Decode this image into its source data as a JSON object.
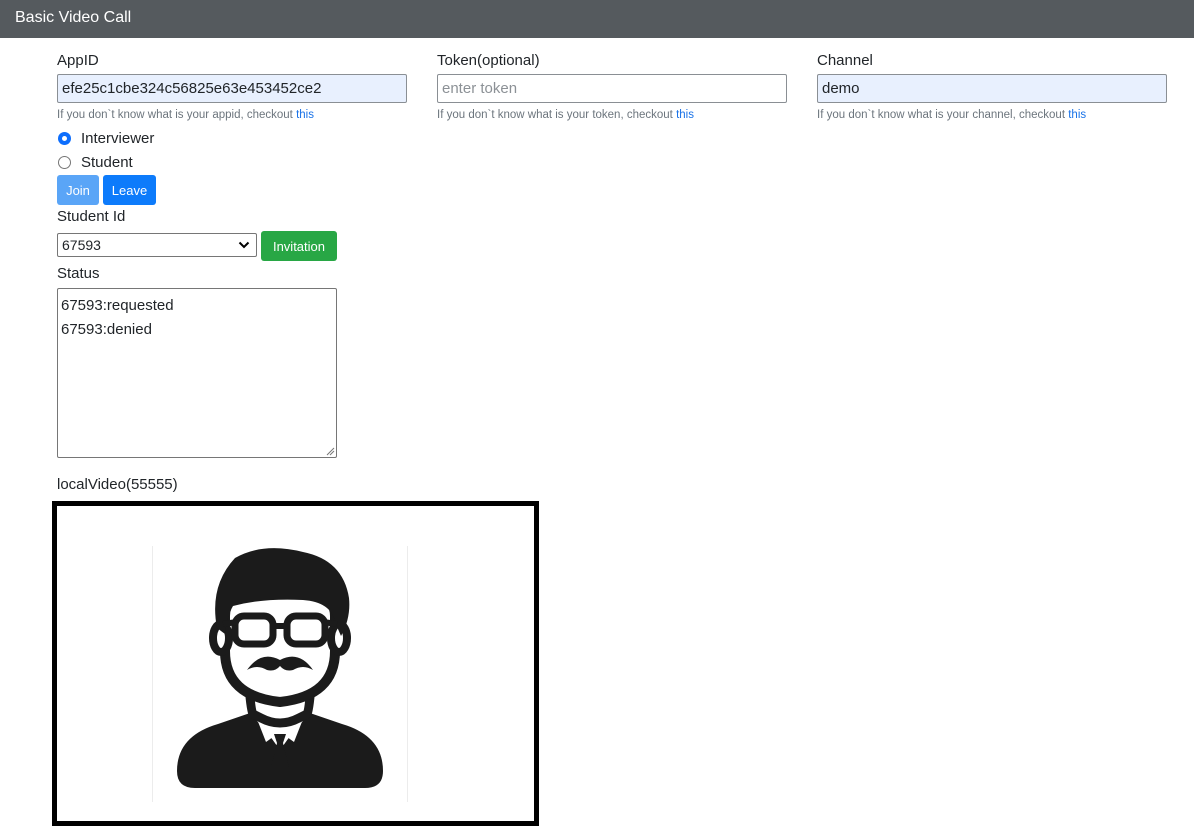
{
  "header": {
    "title": "Basic Video Call"
  },
  "form": {
    "appid": {
      "label": "AppID",
      "value": "efe25c1cbe324c56825e63e453452ce2",
      "help": "If you don`t know what is your appid, checkout ",
      "link": "this"
    },
    "token": {
      "label": "Token(optional)",
      "value": "",
      "placeholder": "enter token",
      "help": "If you don`t know what is your token, checkout ",
      "link": "this"
    },
    "channel": {
      "label": "Channel",
      "value": "demo",
      "help": "If you don`t know what is your channel, checkout ",
      "link": "this"
    }
  },
  "roles": [
    {
      "label": "Interviewer",
      "checked": true
    },
    {
      "label": "Student",
      "checked": false
    }
  ],
  "buttons": {
    "join": "Join",
    "leave": "Leave",
    "invite": "Invitation"
  },
  "student": {
    "label": "Student Id",
    "selected": "67593"
  },
  "status": {
    "label": "Status",
    "lines": [
      "67593:requested",
      "67593:denied"
    ]
  },
  "video": {
    "label": "localVideo(55555)",
    "placeholder_icon": "person-avatar-icon"
  },
  "colors": {
    "navbar": "#555a5e",
    "primary": "#0d7bfb",
    "primary_disabled": "#5aa5f7",
    "success": "#28a745",
    "autofill": "#e8f0fe"
  }
}
